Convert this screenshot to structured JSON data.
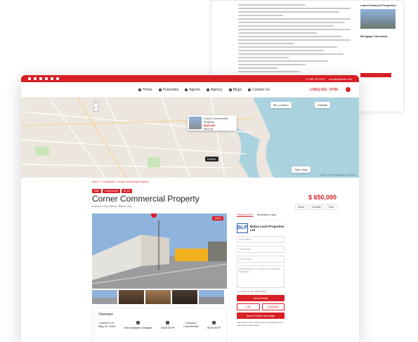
{
  "background_page": {
    "sidebar_title": "Latest Featured Properties",
    "sidebar_subtitle": "Mortgage Calculator"
  },
  "topbar": {
    "phone": "+1 456 78 9124",
    "email": "contact@mail.com"
  },
  "nav": {
    "items": [
      "Home",
      "Properties",
      "Agents",
      "Agency",
      "Blogs",
      "Contact Us"
    ],
    "phone": "(+501) 621 - 6754"
  },
  "map": {
    "my_location": "My Location",
    "satellite": "Satellite",
    "zoom_in": "+",
    "zoom_out": "−",
    "popup_title": "Corner Commercial Property",
    "popup_price": "$650,000",
    "popup_area": "9020 ft²",
    "price_pin": "$ 650K",
    "open_map": "Open map",
    "footer": "Leaflet | © OpenStreetMap contributors"
  },
  "breadcrumb": "Home > Commercial > Corner Commercial Property",
  "listing": {
    "tags": [
      "Sale",
      "Commercial",
      "ID_84"
    ],
    "title": "Corner Commercial Property",
    "address": "Belize City, Belize, Belize City",
    "price": "$ 650,000",
    "actions": [
      "Share",
      "Favorite",
      "Print"
    ],
    "status": "Active"
  },
  "overview": {
    "heading": "Overview",
    "updated_label": "Updated On:",
    "updated_value": "May 10, 2024",
    "garages": "Not Available Garages",
    "size": "9020.00 ft²",
    "category_label": "Category",
    "category_value": "Commercial",
    "lot": "9020.00 ft²"
  },
  "form": {
    "tab_request": "Request Info",
    "tab_tour": "Schedule a tour",
    "agency_name": "Belize Land Properties Ltd",
    "agency_logo": "BLP",
    "name_placeholder": "Your Name",
    "email_placeholder": "Your Email",
    "phone_placeholder": "Your Phone",
    "message_placeholder": "I'm interested in [ Corner Commercial Property ]",
    "consent": "I consent to the GDPR Terms",
    "send_email": "Send Email",
    "call": "Call",
    "whatsapp": "WhatsApp",
    "send_private": "Send Private Message",
    "note": "You need to log in order to send messages and to track your conversations."
  },
  "colors": {
    "brand": "#d81f26"
  }
}
